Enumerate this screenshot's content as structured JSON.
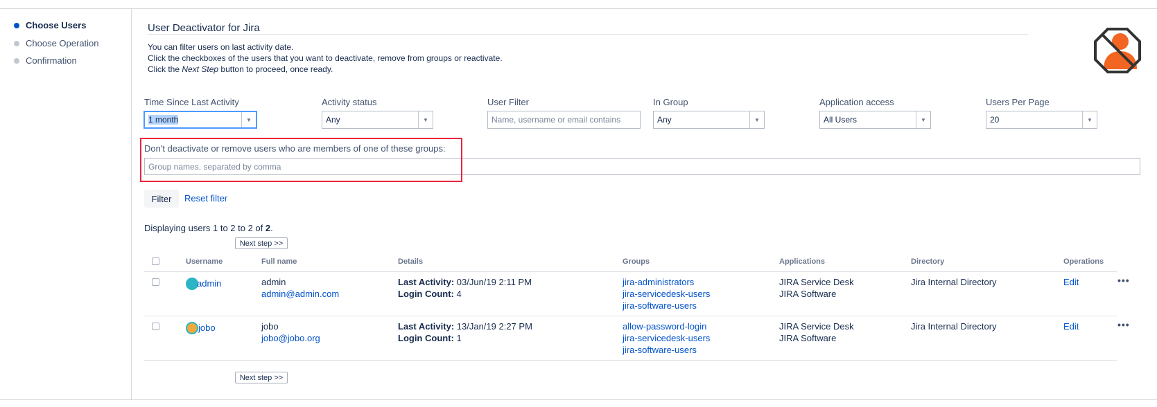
{
  "sidebar": {
    "steps": [
      {
        "label": "Choose Users",
        "active": true
      },
      {
        "label": "Choose Operation",
        "active": false
      },
      {
        "label": "Confirmation",
        "active": false
      }
    ]
  },
  "header": {
    "title": "User Deactivator for Jira",
    "intro_line1": "You can filter users on last activity date.",
    "intro_line2": "Click the checkboxes of the users that you want to deactivate, remove from groups or reactivate.",
    "intro_line3_prefix": "Click the ",
    "intro_line3_emph": "Next Step",
    "intro_line3_suffix": " button to proceed, once ready."
  },
  "filters": {
    "time_since_label": "Time Since Last Activity",
    "time_since_value": "1 month",
    "activity_status_label": "Activity status",
    "activity_status_value": "Any",
    "user_filter_label": "User Filter",
    "user_filter_placeholder": "Name, username or email contains",
    "user_filter_value": "",
    "in_group_label": "In Group",
    "in_group_value": "Any",
    "application_access_label": "Application access",
    "application_access_value": "All Users",
    "users_per_page_label": "Users Per Page",
    "users_per_page_value": "20",
    "exclude_groups_label": "Don't deactivate or remove users who are members of one of these groups:",
    "exclude_groups_placeholder": "Group names, separated by comma",
    "exclude_groups_value": "",
    "filter_button": "Filter",
    "reset_filter_link": "Reset filter"
  },
  "results": {
    "displaying_prefix": "Displaying users 1 to 2 to 2 of ",
    "displaying_total": "2",
    "displaying_suffix": ".",
    "next_step_button": "Next step >>"
  },
  "table": {
    "headers": {
      "username": "Username",
      "full_name": "Full name",
      "details": "Details",
      "groups": "Groups",
      "applications": "Applications",
      "directory": "Directory",
      "operations": "Operations"
    },
    "last_activity_label": "Last Activity:",
    "login_count_label": "Login Count:",
    "rows": [
      {
        "username": "admin",
        "full_name": "admin",
        "email": "admin@admin.com",
        "last_activity": " 03/Jun/19 2:11 PM",
        "login_count": " 4",
        "groups": [
          "jira-administrators",
          "jira-servicedesk-users",
          "jira-software-users"
        ],
        "applications": [
          "JIRA Service Desk",
          "JIRA Software"
        ],
        "directory": "Jira Internal Directory",
        "edit": "Edit",
        "more": "•••",
        "avatar_color": "#2ab4c6"
      },
      {
        "username": "jobo",
        "full_name": "jobo",
        "email": "jobo@jobo.org",
        "last_activity": " 13/Jan/19 2:27 PM",
        "login_count": " 1",
        "groups": [
          "allow-password-login",
          "jira-servicedesk-users",
          "jira-software-users"
        ],
        "applications": [
          "JIRA Service Desk",
          "JIRA Software"
        ],
        "directory": "Jira Internal Directory",
        "edit": "Edit",
        "more": "•••",
        "avatar_color": "#f2a93b"
      }
    ]
  },
  "colors": {
    "accent": "#0052cc",
    "highlight": "#e8263d",
    "logo_orange": "#f26522"
  },
  "icons": {
    "logo": "deactivated-user-icon",
    "dropdown": "chevron-down-icon"
  }
}
